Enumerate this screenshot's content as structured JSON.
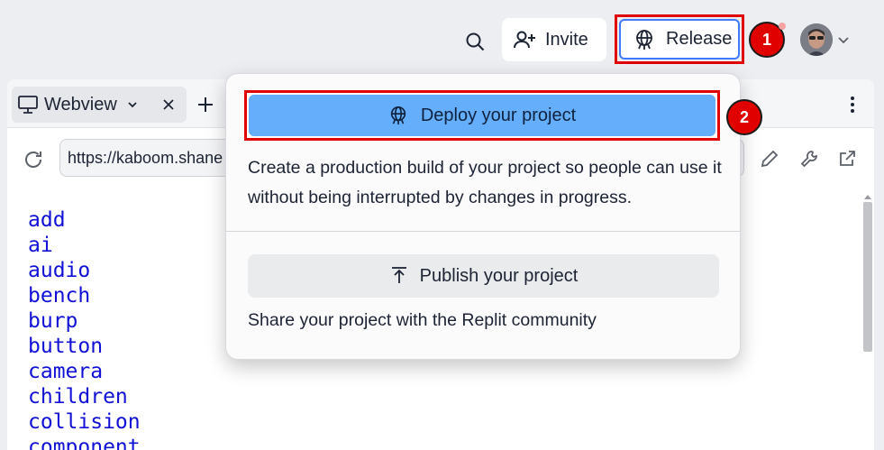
{
  "topbar": {
    "invite_label": "Invite",
    "release_label": "Release"
  },
  "markers": [
    "1",
    "2"
  ],
  "pane": {
    "tab_label": "Webview",
    "url": "https://kaboom.shane"
  },
  "links": [
    "add",
    "ai",
    "audio",
    "bench",
    "burp",
    "button",
    "camera",
    "children",
    "collision",
    "component"
  ],
  "popover": {
    "deploy_label": "Deploy your project",
    "deploy_description": "Create a production build of your project so people can use it without being interrupted by changes in progress.",
    "publish_label": "Publish your project",
    "publish_description": "Share your project with the Replit community"
  },
  "colors": {
    "accent_blue": "#65aefc",
    "annotation_red": "#e00000",
    "link_blue": "#1010d6"
  }
}
